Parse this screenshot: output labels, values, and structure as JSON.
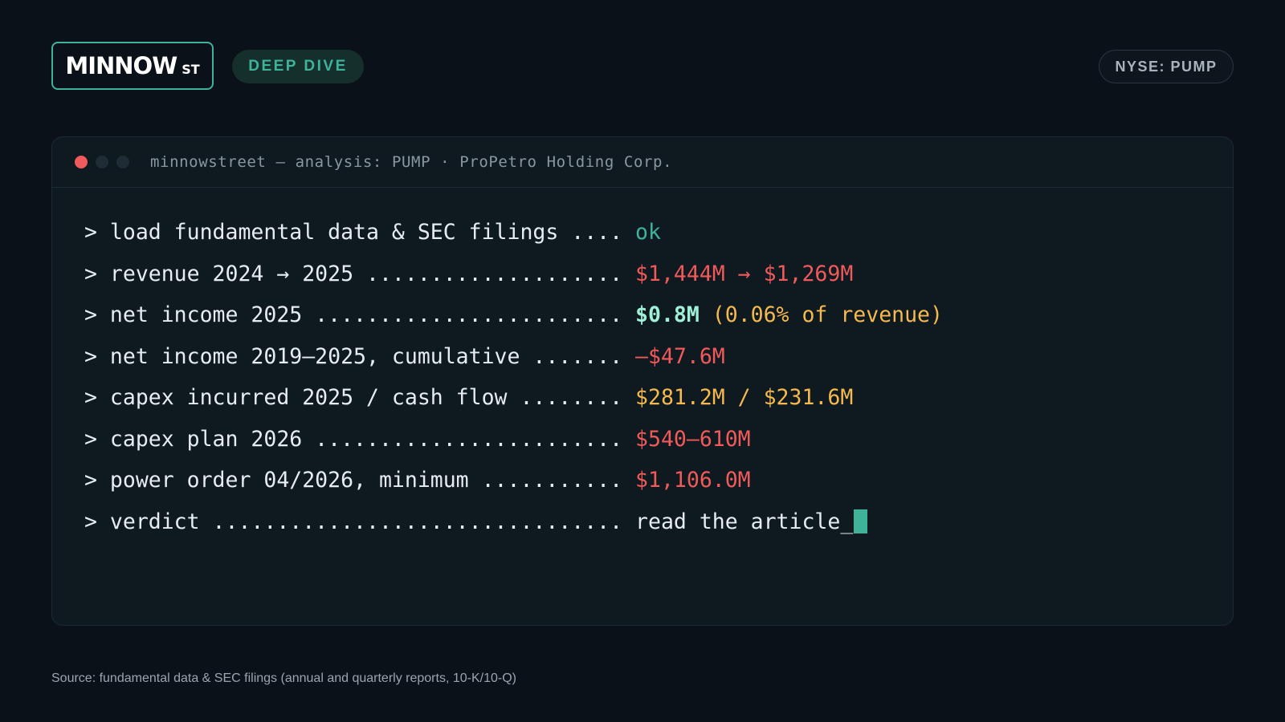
{
  "brand": {
    "name": "MINNOW",
    "suffix": "ST"
  },
  "badge": "DEEP DIVE",
  "ticker": "NYSE: PUMP",
  "terminal": {
    "title": "minnowstreet — analysis: PUMP · ProPetro Holding Corp.",
    "lines": [
      {
        "label": "> load fundamental data & SEC filings .... ",
        "value": "ok"
      },
      {
        "label": "> revenue 2024 → 2025 .................... ",
        "value": "$1,444M → $1,269M"
      },
      {
        "label": "> net income 2025 ........................ ",
        "value": "$0.8M",
        "value2": " (0.06% of revenue)"
      },
      {
        "label": "> net income 2019–2025, cumulative ....... ",
        "value": "–$47.6M"
      },
      {
        "label": "> capex incurred 2025 / cash flow ........ ",
        "value": "$281.2M / $231.6M"
      },
      {
        "label": "> capex plan 2026 ........................ ",
        "value": "$540–610M"
      },
      {
        "label": "> power order 04/2026, minimum ........... ",
        "value": "$1,106.0M"
      },
      {
        "label": "> verdict ................................ ",
        "value": "read the article_"
      }
    ]
  },
  "source": "Source: fundamental data & SEC filings (annual and quarterly reports, 10-K/10-Q)",
  "colors": {
    "accent": "#3fb39a",
    "negative": "#f05a5a",
    "highlight": "#9ff0d6",
    "warning": "#f5b94e",
    "background": "#0b1118"
  }
}
